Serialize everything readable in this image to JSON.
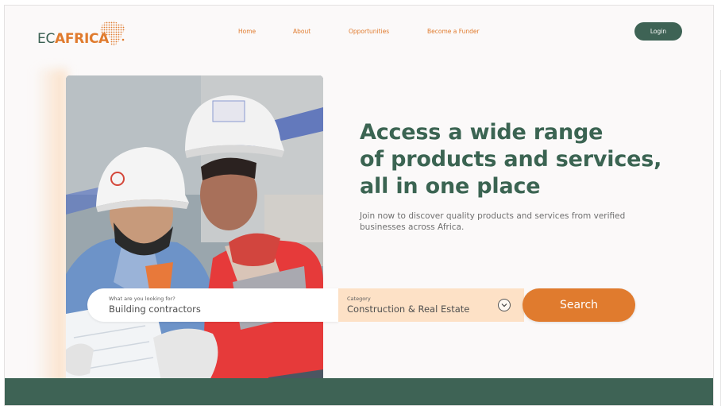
{
  "brand": {
    "prefix": "EC",
    "name": "AFRICA"
  },
  "nav": {
    "home": "Home",
    "about": "About",
    "opportunities": "Opportunities",
    "funder": "Become a Funder"
  },
  "login_label": "Login",
  "hero": {
    "headline": [
      "Access a wide range",
      "of products and services,",
      "all in one place"
    ],
    "subtext": "Join now to discover quality products and services from verified businesses across Africa."
  },
  "search": {
    "label": "What are you looking for?",
    "value": "Building contractors",
    "category_label": "Category",
    "category_value": "Construction & Real Estate",
    "button_label": "Search"
  },
  "colors": {
    "brand_green": "#3e6355",
    "brand_orange": "#e07b2e",
    "category_bg": "#fde1c6"
  }
}
